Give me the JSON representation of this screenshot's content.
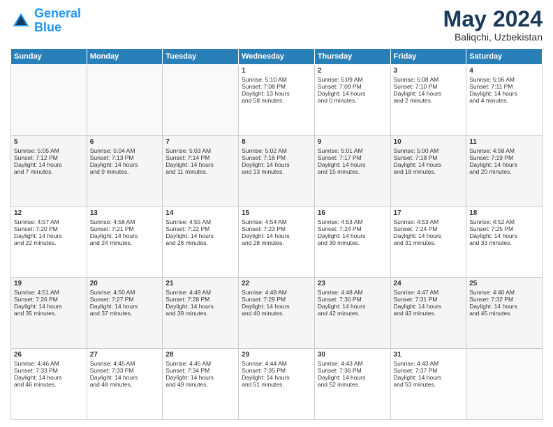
{
  "header": {
    "logo_line1": "General",
    "logo_line2": "Blue",
    "month": "May 2024",
    "location": "Baliqchi, Uzbekistan"
  },
  "days_of_week": [
    "Sunday",
    "Monday",
    "Tuesday",
    "Wednesday",
    "Thursday",
    "Friday",
    "Saturday"
  ],
  "weeks": [
    [
      {
        "day": "",
        "info": ""
      },
      {
        "day": "",
        "info": ""
      },
      {
        "day": "",
        "info": ""
      },
      {
        "day": "1",
        "info": "Sunrise: 5:10 AM\nSunset: 7:08 PM\nDaylight: 13 hours\nand 58 minutes."
      },
      {
        "day": "2",
        "info": "Sunrise: 5:09 AM\nSunset: 7:09 PM\nDaylight: 14 hours\nand 0 minutes."
      },
      {
        "day": "3",
        "info": "Sunrise: 5:08 AM\nSunset: 7:10 PM\nDaylight: 14 hours\nand 2 minutes."
      },
      {
        "day": "4",
        "info": "Sunrise: 5:06 AM\nSunset: 7:11 PM\nDaylight: 14 hours\nand 4 minutes."
      }
    ],
    [
      {
        "day": "5",
        "info": "Sunrise: 5:05 AM\nSunset: 7:12 PM\nDaylight: 14 hours\nand 7 minutes."
      },
      {
        "day": "6",
        "info": "Sunrise: 5:04 AM\nSunset: 7:13 PM\nDaylight: 14 hours\nand 9 minutes."
      },
      {
        "day": "7",
        "info": "Sunrise: 5:03 AM\nSunset: 7:14 PM\nDaylight: 14 hours\nand 11 minutes."
      },
      {
        "day": "8",
        "info": "Sunrise: 5:02 AM\nSunset: 7:16 PM\nDaylight: 14 hours\nand 13 minutes."
      },
      {
        "day": "9",
        "info": "Sunrise: 5:01 AM\nSunset: 7:17 PM\nDaylight: 14 hours\nand 15 minutes."
      },
      {
        "day": "10",
        "info": "Sunrise: 5:00 AM\nSunset: 7:18 PM\nDaylight: 14 hours\nand 18 minutes."
      },
      {
        "day": "11",
        "info": "Sunrise: 4:58 AM\nSunset: 7:19 PM\nDaylight: 14 hours\nand 20 minutes."
      }
    ],
    [
      {
        "day": "12",
        "info": "Sunrise: 4:57 AM\nSunset: 7:20 PM\nDaylight: 14 hours\nand 22 minutes."
      },
      {
        "day": "13",
        "info": "Sunrise: 4:56 AM\nSunset: 7:21 PM\nDaylight: 14 hours\nand 24 minutes."
      },
      {
        "day": "14",
        "info": "Sunrise: 4:55 AM\nSunset: 7:22 PM\nDaylight: 14 hours\nand 26 minutes."
      },
      {
        "day": "15",
        "info": "Sunrise: 4:54 AM\nSunset: 7:23 PM\nDaylight: 14 hours\nand 28 minutes."
      },
      {
        "day": "16",
        "info": "Sunrise: 4:53 AM\nSunset: 7:24 PM\nDaylight: 14 hours\nand 30 minutes."
      },
      {
        "day": "17",
        "info": "Sunrise: 4:53 AM\nSunset: 7:24 PM\nDaylight: 14 hours\nand 31 minutes."
      },
      {
        "day": "18",
        "info": "Sunrise: 4:52 AM\nSunset: 7:25 PM\nDaylight: 14 hours\nand 33 minutes."
      }
    ],
    [
      {
        "day": "19",
        "info": "Sunrise: 4:51 AM\nSunset: 7:26 PM\nDaylight: 14 hours\nand 35 minutes."
      },
      {
        "day": "20",
        "info": "Sunrise: 4:50 AM\nSunset: 7:27 PM\nDaylight: 14 hours\nand 37 minutes."
      },
      {
        "day": "21",
        "info": "Sunrise: 4:49 AM\nSunset: 7:28 PM\nDaylight: 14 hours\nand 39 minutes."
      },
      {
        "day": "22",
        "info": "Sunrise: 4:48 AM\nSunset: 7:29 PM\nDaylight: 14 hours\nand 40 minutes."
      },
      {
        "day": "23",
        "info": "Sunrise: 4:48 AM\nSunset: 7:30 PM\nDaylight: 14 hours\nand 42 minutes."
      },
      {
        "day": "24",
        "info": "Sunrise: 4:47 AM\nSunset: 7:31 PM\nDaylight: 14 hours\nand 43 minutes."
      },
      {
        "day": "25",
        "info": "Sunrise: 4:46 AM\nSunset: 7:32 PM\nDaylight: 14 hours\nand 45 minutes."
      }
    ],
    [
      {
        "day": "26",
        "info": "Sunrise: 4:46 AM\nSunset: 7:33 PM\nDaylight: 14 hours\nand 46 minutes."
      },
      {
        "day": "27",
        "info": "Sunrise: 4:45 AM\nSunset: 7:33 PM\nDaylight: 14 hours\nand 48 minutes."
      },
      {
        "day": "28",
        "info": "Sunrise: 4:45 AM\nSunset: 7:34 PM\nDaylight: 14 hours\nand 49 minutes."
      },
      {
        "day": "29",
        "info": "Sunrise: 4:44 AM\nSunset: 7:35 PM\nDaylight: 14 hours\nand 51 minutes."
      },
      {
        "day": "30",
        "info": "Sunrise: 4:43 AM\nSunset: 7:36 PM\nDaylight: 14 hours\nand 52 minutes."
      },
      {
        "day": "31",
        "info": "Sunrise: 4:43 AM\nSunset: 7:37 PM\nDaylight: 14 hours\nand 53 minutes."
      },
      {
        "day": "",
        "info": ""
      }
    ]
  ]
}
